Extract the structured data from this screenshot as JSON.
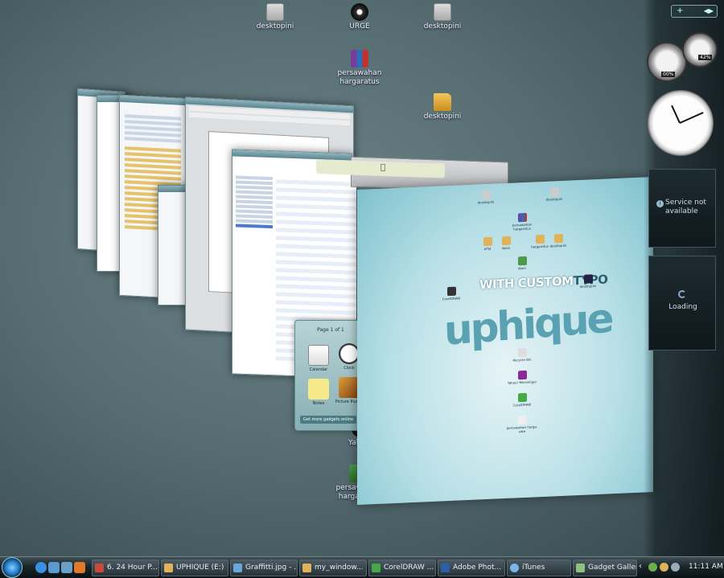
{
  "desktop_icons": [
    {
      "label": "desktopini",
      "type": "doc"
    },
    {
      "label": "URGE",
      "type": "app"
    },
    {
      "label": "desktopini",
      "type": "doc"
    },
    {
      "label": "persawahan hargaratus",
      "type": "rar"
    },
    {
      "label": "desktopini",
      "type": "folder"
    },
    {
      "label": "Yahoo!",
      "type": "app"
    },
    {
      "label": "persawahan harga-sate",
      "type": "xls"
    }
  ],
  "flip3d": {
    "photoshop_title": "Adobe Photoshop",
    "itunes_title": "iTunes",
    "gadget_gallery": {
      "page": "Page 1 of 1",
      "tiles": [
        "Calendar",
        "Clock",
        "Notes",
        "Picture Puzzle"
      ],
      "more_link": "Get more gadgets online"
    },
    "front": {
      "brand_line": "WITH CUSTOM",
      "brand_accent": "TYPO",
      "brand_main": "uphique",
      "icons": [
        "desktopini",
        "desktopini",
        "persawahan hargaratus",
        "efild",
        "dena",
        "hargaratus",
        "desktopini",
        "doen",
        "CorelDRAW",
        "desktopini",
        "Recycle Bin",
        "Yahoo! Messenger",
        "CorelDRAW",
        "persawahan harga-sate"
      ]
    }
  },
  "sidebar": {
    "add_label": "+",
    "cpu_percent": "00%",
    "memory_percent": "42%",
    "clock": {
      "hour": 11,
      "minute": 11
    },
    "weather_message": "Service not available",
    "feed_message": "Loading"
  },
  "taskbar": {
    "buttons": [
      {
        "label": "6. 24 Hour P...",
        "color": "#c94a3a"
      },
      {
        "label": "UPHIQUE (E:)",
        "color": "#e0b35a"
      },
      {
        "label": "Graffitti.jpg - ...",
        "color": "#6aa7d8"
      },
      {
        "label": "my_window...",
        "color": "#e0b35a"
      },
      {
        "label": "CorelDRAW ...",
        "color": "#46a846"
      },
      {
        "label": "Adobe Phot...",
        "color": "#2c5fa8"
      },
      {
        "label": "iTunes",
        "color": "#7ab6e8"
      },
      {
        "label": "Gadget Gallery",
        "color": "#8fc27e"
      }
    ],
    "clock": "11:11 AM"
  }
}
